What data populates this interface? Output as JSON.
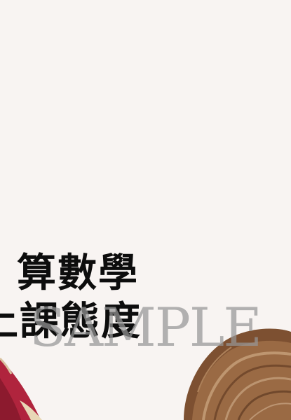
{
  "title": {
    "line1": "算數學",
    "line2": "上課態度"
  },
  "watermark": "SAMPLE",
  "colors": {
    "background": "#f8f4f2",
    "title_text": "#0d0d0d",
    "watermark": "#969696",
    "hair_brown": "#8a5a35",
    "garment_red": "#a31f36"
  }
}
